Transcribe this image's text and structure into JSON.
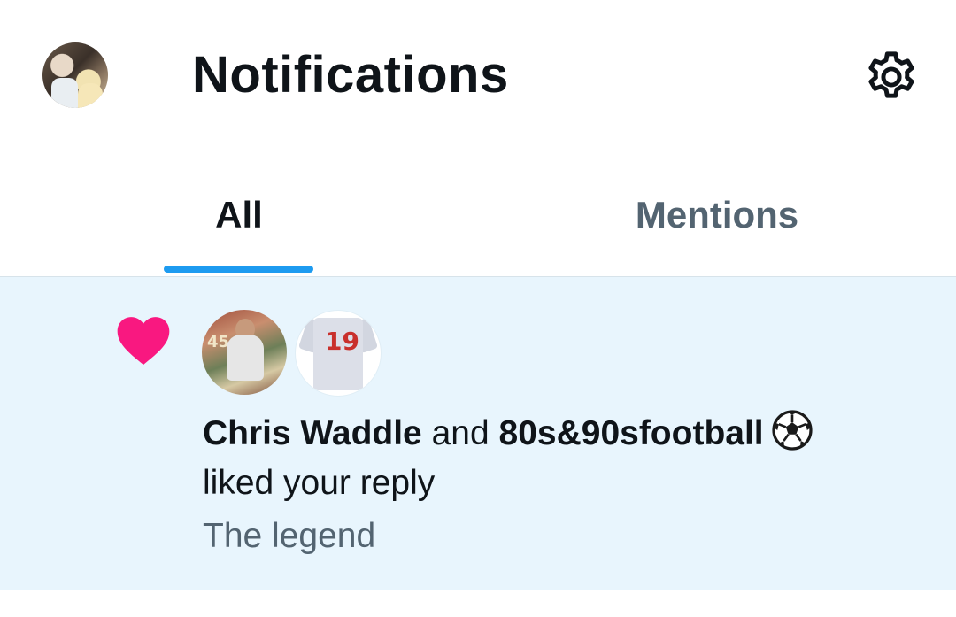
{
  "header": {
    "title": "Notifications",
    "avatar_icon": "profile-avatar",
    "settings_icon": "gear-icon"
  },
  "tabs": [
    {
      "label": "All",
      "active": true
    },
    {
      "label": "Mentions",
      "active": false
    }
  ],
  "colors": {
    "accent": "#1d9bf0",
    "like": "#f91880",
    "unread_background": "#e8f5fd",
    "secondary_text": "#536471"
  },
  "notification": {
    "type_icon": "heart-icon",
    "actor1": "Chris Waddle",
    "conjunction": "and",
    "actor2": "80s&90sfootball",
    "actor2_emoji_icon": "soccer-ball-icon",
    "action": "liked your reply",
    "snippet": "The legend",
    "actor2_avatar_number": "19"
  }
}
